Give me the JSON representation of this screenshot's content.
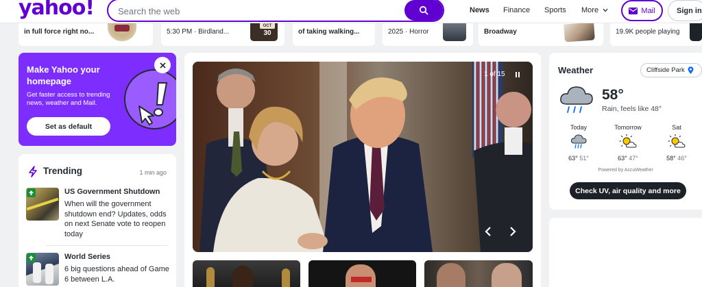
{
  "header": {
    "logo": "yahoo!",
    "search_placeholder": "Search the web",
    "nav": [
      "News",
      "Finance",
      "Sports",
      "More"
    ],
    "mail_label": "Mail",
    "signin_label": "Sign in"
  },
  "strip": [
    {
      "text": "in full force right no..."
    },
    {
      "text": "5:30 PM · Birdland..."
    },
    {
      "badge_month": "OCT",
      "badge_day": "30"
    },
    {
      "text": "of taking walking..."
    },
    {
      "text": "2025 · Horror"
    },
    {
      "text": "Broadway"
    },
    {
      "text": "19.9K people playing"
    }
  ],
  "promo": {
    "title": "Make Yahoo your homepage",
    "description": "Get faster access to trending news, weather and Mail.",
    "button": "Set as default"
  },
  "trending": {
    "title": "Trending",
    "updated": "1 min ago",
    "items": [
      {
        "headline": "US Government Shutdown",
        "body": "When will the government shutdown end? Updates, odds on next Senate vote to reopen today"
      },
      {
        "headline": "World Series",
        "body": "6 big questions ahead of Game 6 between L.A."
      }
    ]
  },
  "hero": {
    "counter": "1 of 15"
  },
  "weather": {
    "title": "Weather",
    "location": "Cliffside Park",
    "temp": "58°",
    "condition": "Rain, feels like 48°",
    "days": [
      {
        "label": "Today",
        "high": "63°",
        "low": "51°",
        "icon": "rain-cloud-icon"
      },
      {
        "label": "Tomorrow",
        "high": "63°",
        "low": "47°",
        "icon": "partly-sunny-icon"
      },
      {
        "label": "Sat",
        "high": "58°",
        "low": "46°",
        "icon": "partly-sunny-icon"
      }
    ],
    "powered_by": "Powered by AccuWeather",
    "button": "Check UV, air quality and more"
  },
  "colors": {
    "brand": "#6001d2",
    "promo": "#7d2eff",
    "dark_button": "#1d2228"
  }
}
